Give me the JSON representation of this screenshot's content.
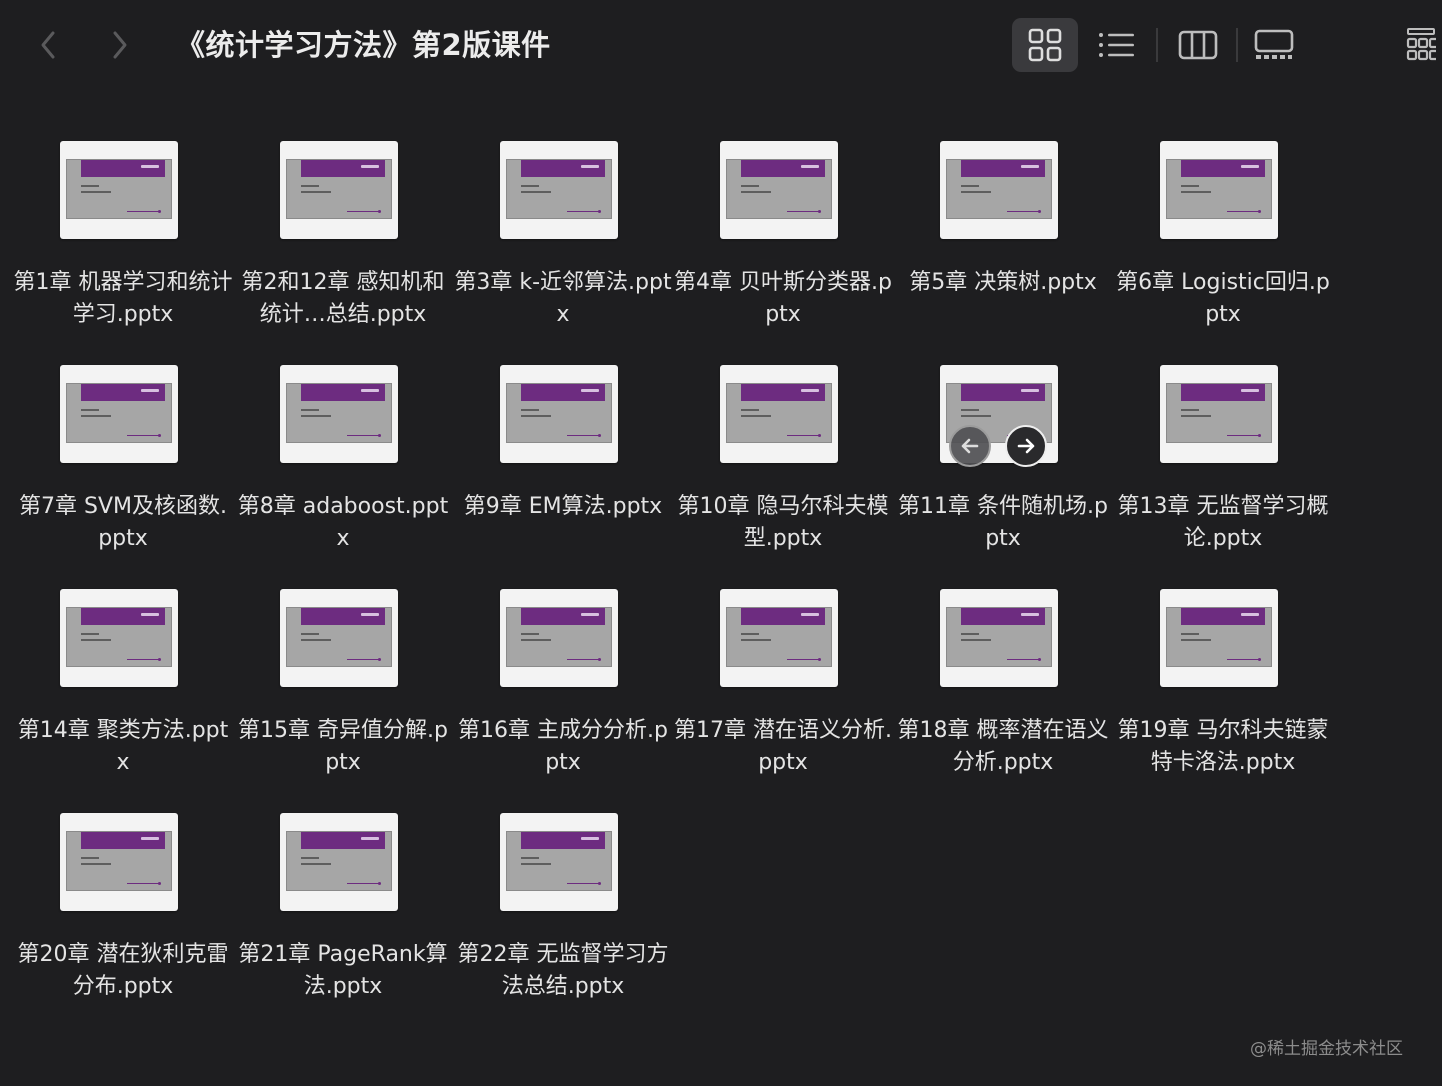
{
  "window": {
    "title": "《统计学习方法》第2版课件",
    "back_icon": "chevron-left-icon",
    "forward_icon": "chevron-right-icon"
  },
  "view_modes": [
    {
      "name": "icon-view",
      "icon": "grid-icon",
      "selected": true
    },
    {
      "name": "list-view",
      "icon": "list-icon",
      "selected": false
    },
    {
      "name": "column-view",
      "icon": "columns-icon",
      "selected": false
    },
    {
      "name": "gallery-view",
      "icon": "gallery-icon",
      "selected": false
    },
    {
      "name": "group-view",
      "icon": "group-icon",
      "selected": false
    }
  ],
  "files": [
    {
      "label": "第1章 机器学习和统计学习.pptx"
    },
    {
      "label": "第2和12章 感知机和统计…总结.pptx"
    },
    {
      "label": "第3章 k-近邻算法.pptx"
    },
    {
      "label": "第4章 贝叶斯分类器.pptx"
    },
    {
      "label": "第5章 决策树.pptx"
    },
    {
      "label": "第6章 Logistic回归.pptx"
    },
    {
      "label": "第7章 SVM及核函数.pptx"
    },
    {
      "label": "第8章 adaboost.pptx"
    },
    {
      "label": "第9章 EM算法.pptx"
    },
    {
      "label": "第10章 隐马尔科夫模型.pptx"
    },
    {
      "label": "第11章 条件随机场.pptx"
    },
    {
      "label": "第13章 无监督学习概论.pptx"
    },
    {
      "label": "第14章 聚类方法.pptx"
    },
    {
      "label": "第15章 奇异值分解.pptx"
    },
    {
      "label": "第16章 主成分分析.pptx"
    },
    {
      "label": "第17章 潜在语义分析.pptx"
    },
    {
      "label": "第18章 概率潜在语义分析.pptx"
    },
    {
      "label": "第19章 马尔科夫链蒙特卡洛法.pptx"
    },
    {
      "label": "第20章 潜在狄利克雷分布.pptx"
    },
    {
      "label": "第21章 PageRank算法.pptx"
    },
    {
      "label": "第22章 无监督学习方法总结.pptx"
    }
  ],
  "hover_controls": {
    "prev_icon": "arrow-left-icon",
    "next_icon": "arrow-right-icon"
  },
  "watermark": "@稀土掘金技术社区"
}
